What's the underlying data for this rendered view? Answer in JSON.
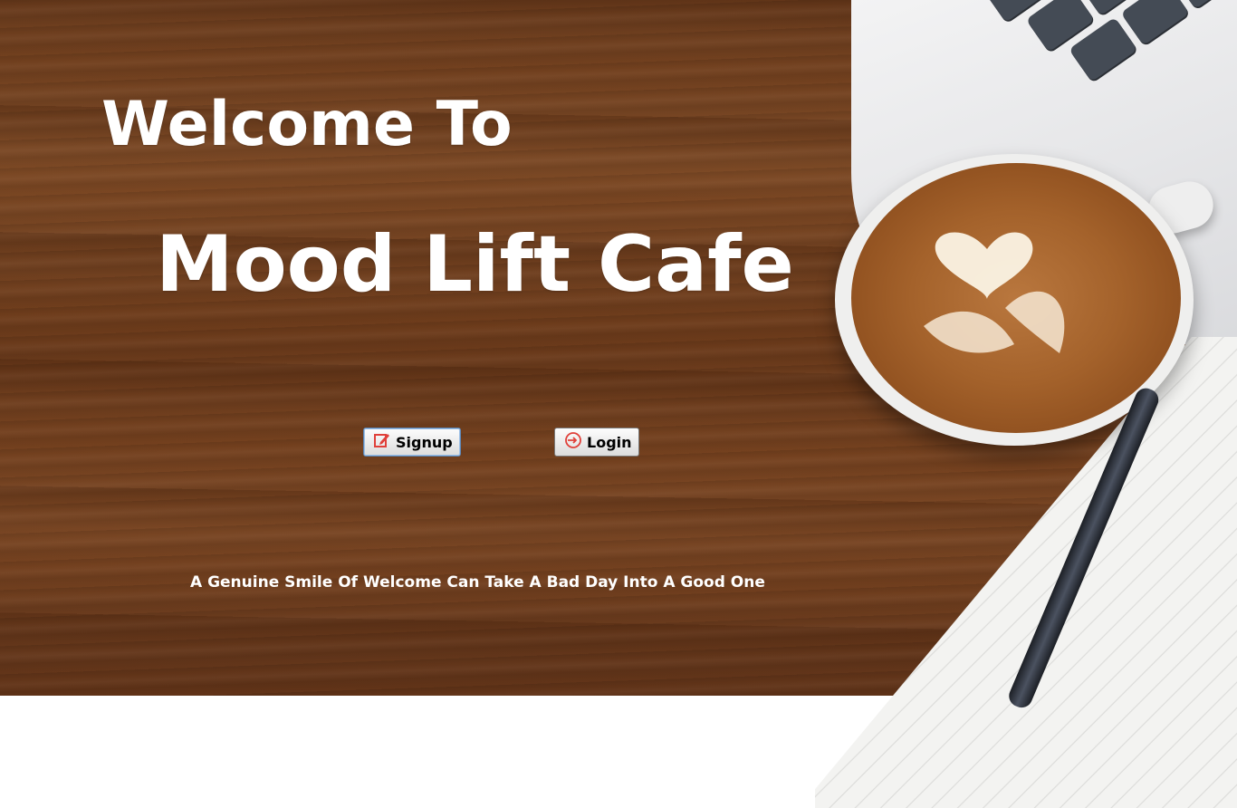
{
  "header": {
    "welcome_text": "Welcome To",
    "cafe_name": "Mood Lift Cafe"
  },
  "actions": {
    "signup_label": "Signup",
    "login_label": "Login",
    "signup_icon": "edit-icon",
    "login_icon": "login-icon"
  },
  "footer": {
    "tagline": "A Genuine Smile Of Welcome Can Take A Bad Day Into A Good One"
  },
  "colors": {
    "text": "#ffffff",
    "background_wood": "#6b3c1d",
    "signup_icon_color": "#e0403a",
    "login_icon_color": "#e0403a"
  }
}
